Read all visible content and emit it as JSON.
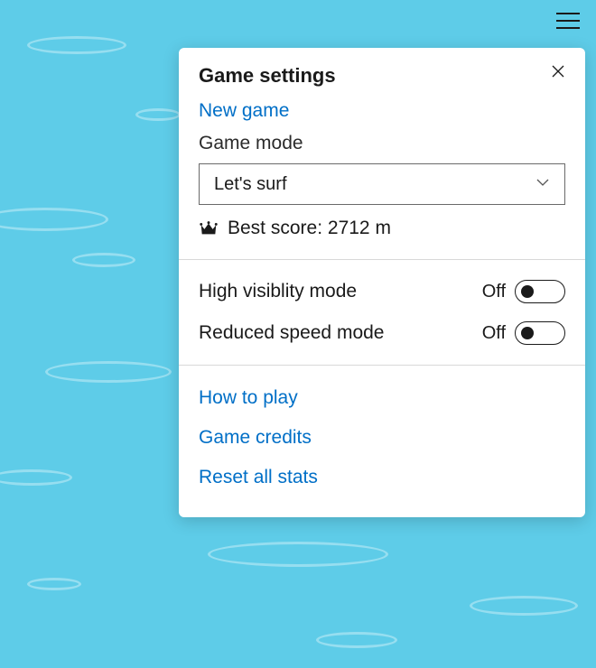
{
  "panel": {
    "title": "Game settings",
    "newGame": "New game",
    "gameModeLabel": "Game mode",
    "gameModeValue": "Let's surf",
    "bestScorePrefix": "Best score: ",
    "bestScoreValue": "2712 m",
    "toggles": {
      "highVisibility": {
        "label": "High visiblity mode",
        "state": "Off"
      },
      "reducedSpeed": {
        "label": "Reduced speed mode",
        "state": "Off"
      }
    },
    "links": {
      "howToPlay": "How to play",
      "gameCredits": "Game credits",
      "resetStats": "Reset all stats"
    }
  }
}
